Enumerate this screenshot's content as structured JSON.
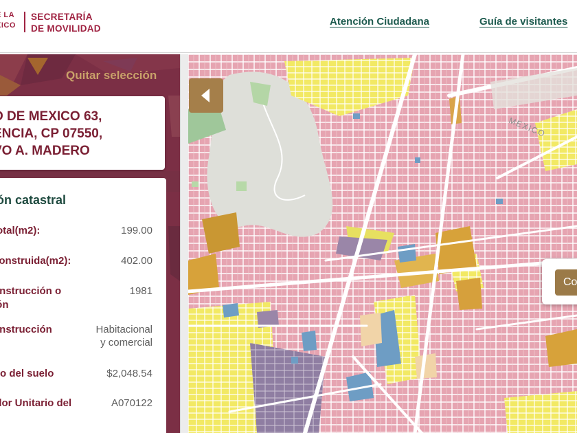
{
  "header": {
    "logo_left_line1": "E LA",
    "logo_left_line2": "XICO",
    "logo_right_line1": "SECRETARÍA",
    "logo_right_line2": "DE MOVILIDAD",
    "nav": [
      {
        "label": "Atención Ciudadana"
      },
      {
        "label": "Guía de visitantes"
      }
    ]
  },
  "panel": {
    "clear_selection": "Quitar selección",
    "address": [
      "O DE MEXICO 63,",
      "ENCIA, CP 07550,",
      "VO A. MADERO"
    ],
    "info_title": "ión catastral",
    "rows": [
      {
        "label": "total(m2):",
        "value": "199.00"
      },
      {
        "label": "construida(m2):",
        "value": "402.00"
      },
      {
        "label_lines": [
          "onstrucción o",
          "ión"
        ],
        "value": "1981"
      },
      {
        "label": "onstrucción",
        "value_lines": [
          "Habitacional",
          "y comercial"
        ]
      },
      {
        "label": "rio del suelo",
        "value": "$2,048.54"
      },
      {
        "label_lines": [
          "alor Unitario del",
          ")"
        ],
        "value": "A070122"
      }
    ]
  },
  "map": {
    "street_label": "MEXICO",
    "popup_button": "Co",
    "colors": {
      "habitational": "#e4a3b0",
      "mixed": "#f3ea5e",
      "commercial": "#6a9ec5",
      "equipment": "#8e7fa0",
      "industrial": "#d9a03a",
      "open_space": "#b7d9a8",
      "street": "#ffffff",
      "background": "#e9e7e2"
    }
  }
}
